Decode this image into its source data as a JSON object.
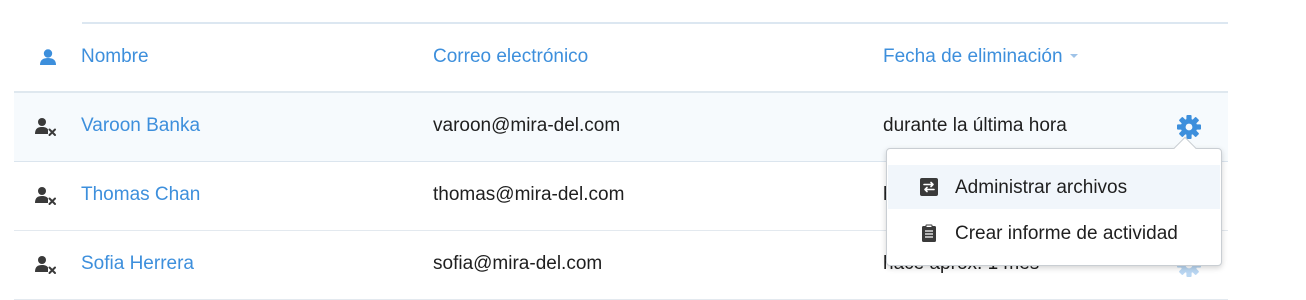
{
  "table": {
    "columns": {
      "name": "Nombre",
      "email": "Correo electrónico",
      "deleted_date": "Fecha de eliminación"
    },
    "sort": {
      "column": "deleted_date",
      "direction": "descending"
    },
    "rows": [
      {
        "name": "Varoon Banka",
        "email": "varoon@mira-del.com",
        "deleted": "durante la última hora",
        "selected": true
      },
      {
        "name": "Thomas Chan",
        "email": "thomas@mira-del.com",
        "deleted": "h",
        "selected": false
      },
      {
        "name": "Sofia Herrera",
        "email": "sofia@mira-del.com",
        "deleted": "hace aprox. 1 mes",
        "selected": false
      }
    ]
  },
  "row_menu": {
    "items": [
      {
        "label": "Administrar archivos",
        "icon": "transfer-files-icon",
        "hovered": true
      },
      {
        "label": "Crear informe de actividad",
        "icon": "clipboard-report-icon",
        "hovered": false
      }
    ]
  },
  "icons": {
    "user_column": "user-icon",
    "deleted_user": "deleted-user-icon",
    "row_actions": "gear-icon"
  },
  "colors": {
    "link_blue": "#3d8fdc",
    "selected_row_bg": "#f6fafd",
    "menu_hover_bg": "#f1f6fb"
  }
}
